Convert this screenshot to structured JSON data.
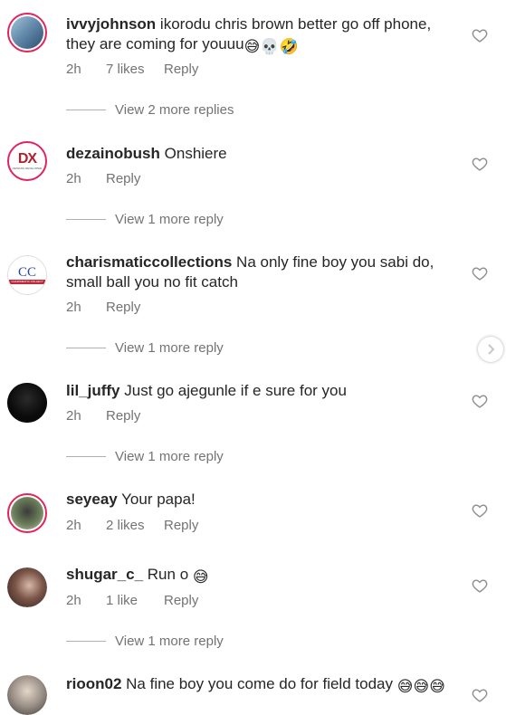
{
  "comments": [
    {
      "username": "ivvyjohnson",
      "text": "ikorodu chris brown better go off phone, they are coming for youuu",
      "emojis": [
        "😅",
        "💀",
        "🤣"
      ],
      "time": "2h",
      "likes": "7 likes",
      "reply": "Reply",
      "view_replies": "View 2 more replies"
    },
    {
      "username": "dezainobush",
      "text": "Onshiere",
      "time": "2h",
      "likes": "",
      "reply": "Reply",
      "view_replies": "View 1 more reply",
      "avatar_text": "DX",
      "avatar_subtext": "DESIGNS DEVELOPER"
    },
    {
      "username": "charismaticcollections",
      "text": "Na only fine boy you sabi do, small ball you no fit catch",
      "time": "2h",
      "likes": "",
      "reply": "Reply",
      "view_replies": "View 1 more reply",
      "avatar_text": "CC",
      "avatar_subtext": "CHARISMATIC COLLECT"
    },
    {
      "username": "lil_juffy",
      "text": "Just go ajegunle if e sure for you",
      "time": "2h",
      "likes": "",
      "reply": "Reply",
      "view_replies": "View 1 more reply"
    },
    {
      "username": "seyeay",
      "text": "Your papa!",
      "time": "2h",
      "likes": "2 likes",
      "reply": "Reply",
      "view_replies": ""
    },
    {
      "username": "shugar_c_",
      "text": "Run o",
      "emojis": [
        "😅"
      ],
      "time": "2h",
      "likes": "1 like",
      "reply": "Reply",
      "view_replies": "View 1 more reply"
    },
    {
      "username": "rioon02",
      "text": "Na fine boy you come do for field today",
      "emojis": [
        "😅",
        "😅",
        "😅"
      ],
      "time": "",
      "likes": "",
      "reply": "",
      "view_replies": ""
    }
  ],
  "icons": {
    "heart": "heart-outline-icon",
    "next": "chevron-right-icon"
  },
  "colors": {
    "ring": "#e0245e",
    "muted": "#737373",
    "text": "#262626"
  }
}
